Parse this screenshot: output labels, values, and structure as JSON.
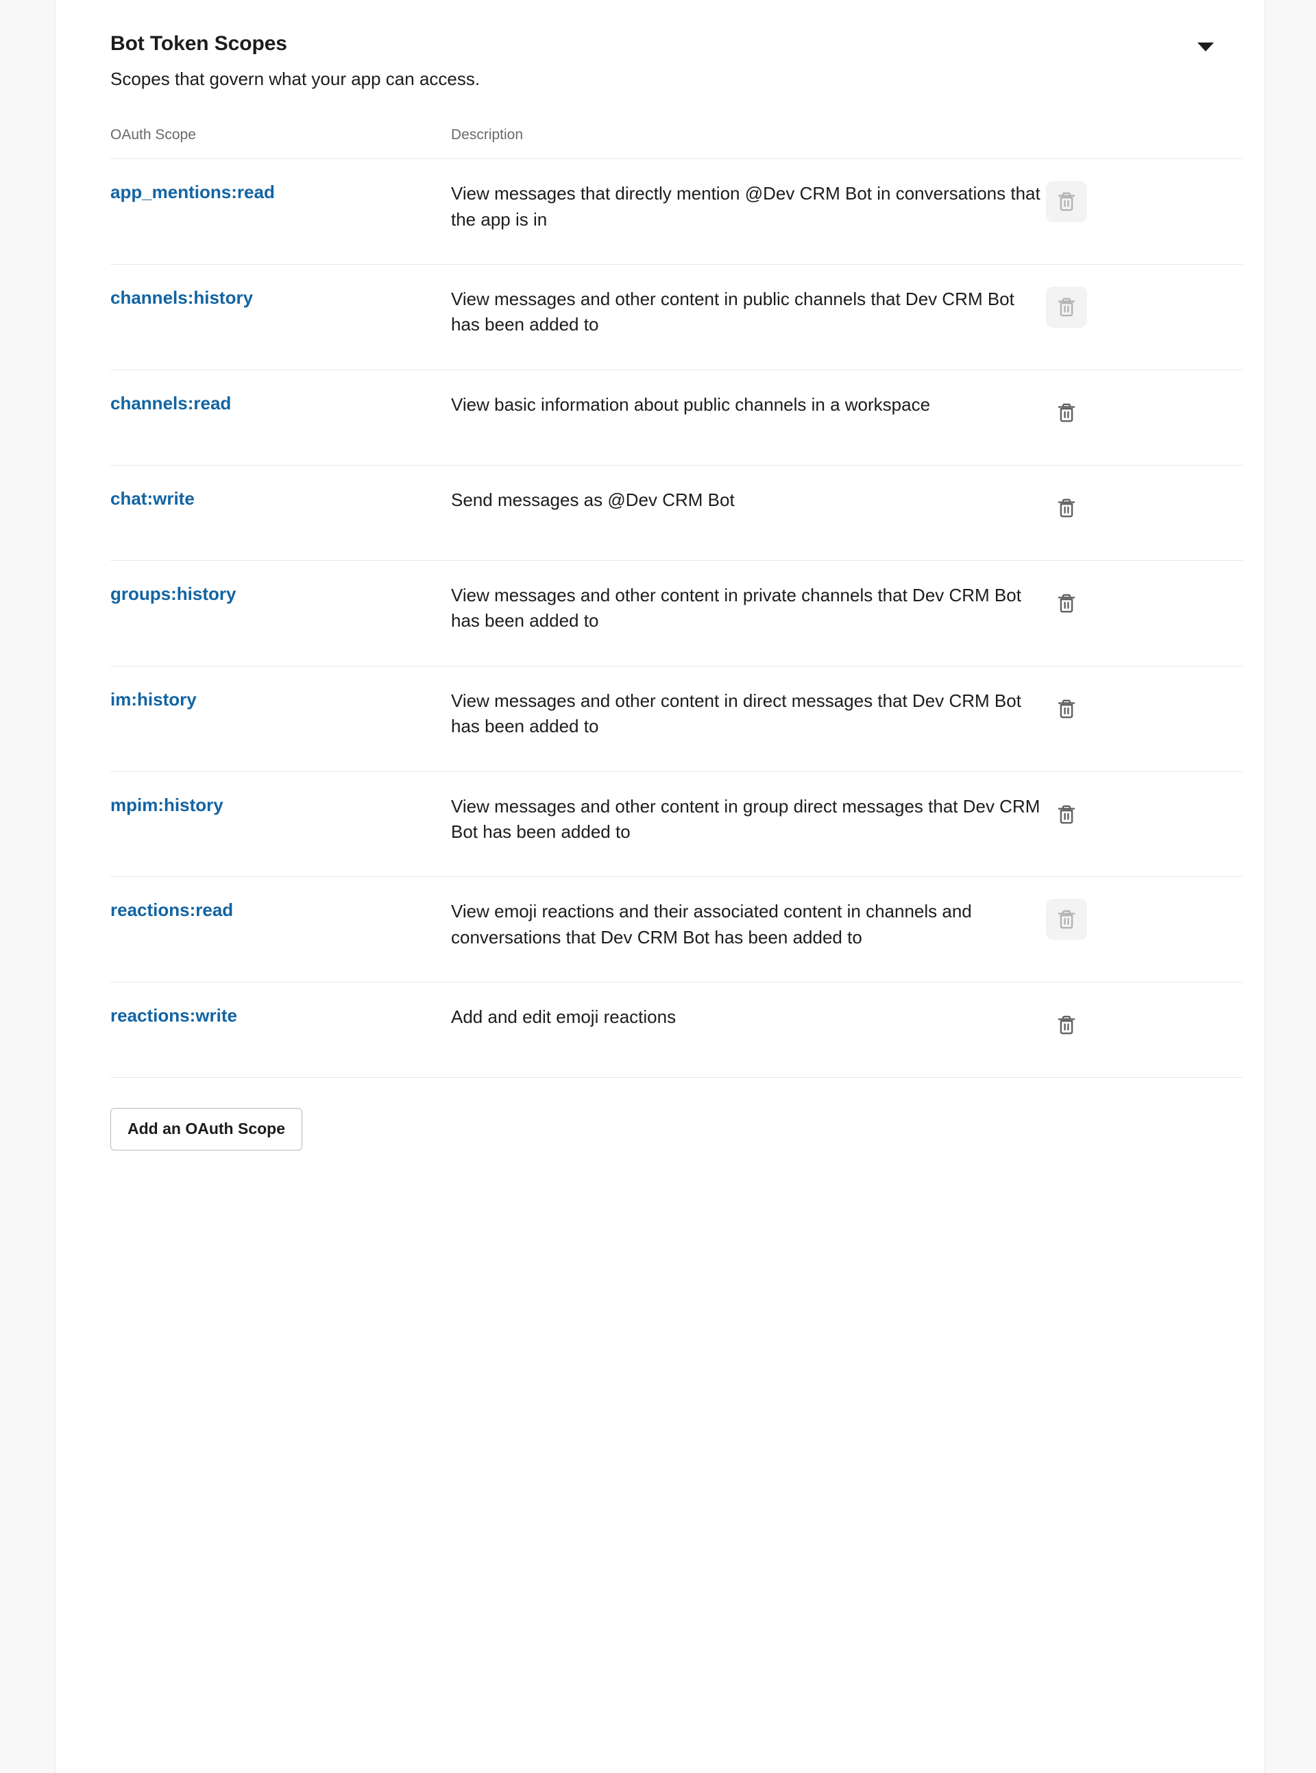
{
  "section": {
    "title": "Bot Token Scopes",
    "subtitle": "Scopes that govern what your app can access.",
    "collapse_icon": "chevron-down-icon"
  },
  "table": {
    "headers": {
      "scope": "OAuth Scope",
      "description": "Description"
    },
    "rows": [
      {
        "scope": "app_mentions:read",
        "description": "View messages that directly mention @Dev CRM Bot in conversations that the app is in",
        "delete_icon": "trash-icon",
        "delete_hovered": true
      },
      {
        "scope": "channels:history",
        "description": "View messages and other content in public channels that Dev CRM Bot has been added to",
        "delete_icon": "trash-icon",
        "delete_hovered": true
      },
      {
        "scope": "channels:read",
        "description": "View basic information about public channels in a workspace",
        "delete_icon": "trash-icon",
        "delete_hovered": false
      },
      {
        "scope": "chat:write",
        "description": "Send messages as @Dev CRM Bot",
        "delete_icon": "trash-icon",
        "delete_hovered": false
      },
      {
        "scope": "groups:history",
        "description": "View messages and other content in private channels that Dev CRM Bot has been added to",
        "delete_icon": "trash-icon",
        "delete_hovered": false
      },
      {
        "scope": "im:history",
        "description": "View messages and other content in direct messages that Dev CRM Bot has been added to",
        "delete_icon": "trash-icon",
        "delete_hovered": false
      },
      {
        "scope": "mpim:history",
        "description": "View messages and other content in group direct messages that Dev CRM Bot has been added to",
        "delete_icon": "trash-icon",
        "delete_hovered": false
      },
      {
        "scope": "reactions:read",
        "description": "View emoji reactions and their associated content in channels and conversations that Dev CRM Bot has been added to",
        "delete_icon": "trash-icon",
        "delete_hovered": true
      },
      {
        "scope": "reactions:write",
        "description": "Add and edit emoji reactions",
        "delete_icon": "trash-icon",
        "delete_hovered": false
      }
    ]
  },
  "footer": {
    "add_scope_label": "Add an OAuth Scope"
  },
  "colors": {
    "link": "#1264a3",
    "text": "#1d1c1d",
    "muted": "#696969",
    "divider": "#e8e8e8",
    "icon": "#616061",
    "icon_hovered": "#b3b3b3",
    "hover_bg": "#f3f3f3",
    "page_bg": "#f8f8f8",
    "card_bg": "#ffffff"
  }
}
